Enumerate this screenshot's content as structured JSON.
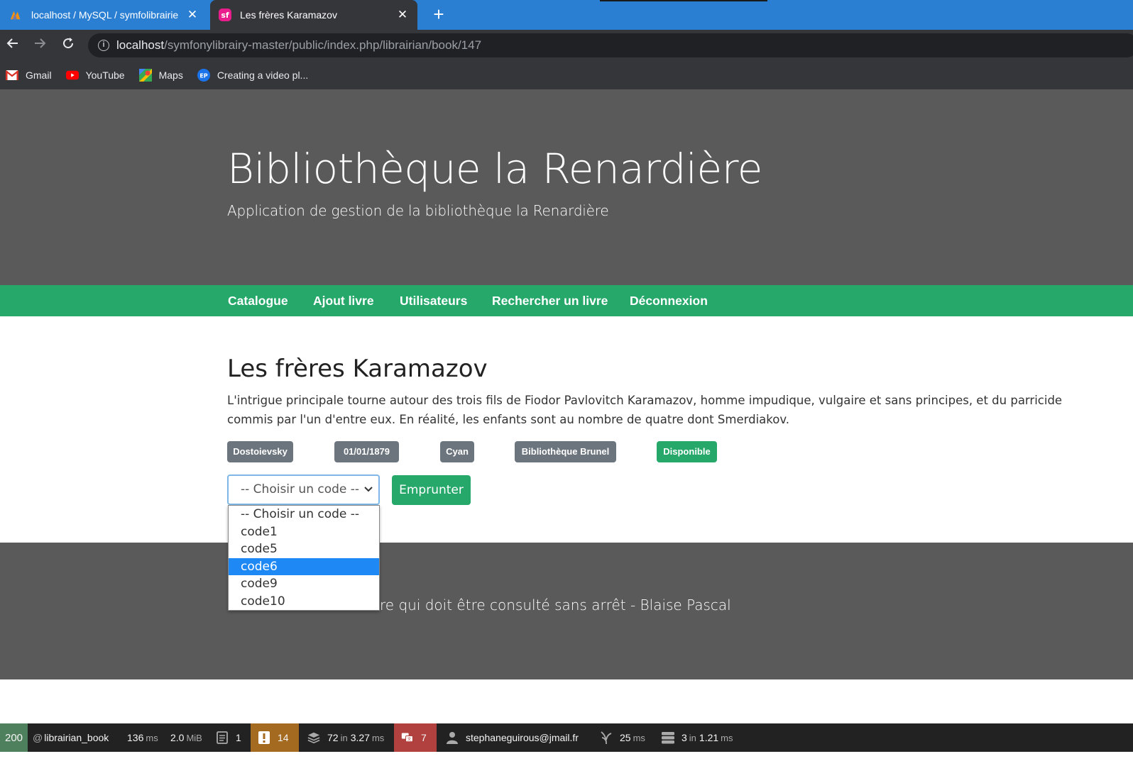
{
  "browser": {
    "tabs": [
      {
        "title": "localhost / MySQL / symfolibrairie",
        "icon": "phpmyadmin-icon"
      },
      {
        "title": "Les frères Karamazov",
        "icon": "symfony-icon"
      }
    ],
    "url_host": "localhost",
    "url_path": "/symfonylibrairy-master/public/index.php/librairian/book/147",
    "bookmarks": [
      {
        "label": "Gmail",
        "icon": "gmail-icon"
      },
      {
        "label": "YouTube",
        "icon": "youtube-icon"
      },
      {
        "label": "Maps",
        "icon": "maps-icon"
      },
      {
        "label": "Creating a video pl...",
        "icon": "ep-icon"
      }
    ]
  },
  "hero": {
    "title": "Bibliothèque la Renardière",
    "subtitle": "Application de gestion de la bibliothèque la Renardière"
  },
  "nav": [
    "Catalogue",
    "Ajout livre",
    "Utilisateurs",
    "Rechercher un livre",
    "Déconnexion"
  ],
  "book": {
    "title": "Les frères Karamazov",
    "description": "L'intrigue principale tourne autour des trois fils de Fiodor Pavlovitch Karamazov, homme impudique, vulgaire et sans principes, et du parricide commis par l'un d'entre eux. En réalité, les enfants sont au nombre de quatre dont Smerdiakov.",
    "badges": {
      "author": "Dostoievsky",
      "date": "01/01/1879",
      "color": "Cyan",
      "library": "Bibliothèque Brunel",
      "status": "Disponible"
    }
  },
  "form": {
    "select_value": "-- Choisir un code --",
    "options": [
      "-- Choisir un code --",
      "code1",
      "code5",
      "code6",
      "code9",
      "code10"
    ],
    "highlighted_option": "code6",
    "button": "Emprunter"
  },
  "footer": {
    "quote_visible": "re qui doit être consulté sans arrêt - Blaise Pascal"
  },
  "toolbar": {
    "status": "200",
    "route": "librairian_book",
    "time": "136",
    "time_unit": "ms",
    "memory": "2.0",
    "memory_unit": "MiB",
    "forms": "1",
    "logs": "14",
    "queries": "72",
    "queries_in": "in",
    "queries_time": "3.27",
    "queries_unit": "ms",
    "errors": "7",
    "user": "stephaneguirous@jmail.fr",
    "render_time": "25",
    "render_unit": "ms",
    "cache": "3",
    "cache_in": "in",
    "cache_time": "1.21",
    "cache_unit": "ms"
  },
  "colors": {
    "accent_green": "#25a86a",
    "hero_gray": "#5a5a5a",
    "badge_gray": "#6c757d",
    "tabstrip_blue": "#2b7fd3",
    "select_highlight": "#1e88f5"
  }
}
